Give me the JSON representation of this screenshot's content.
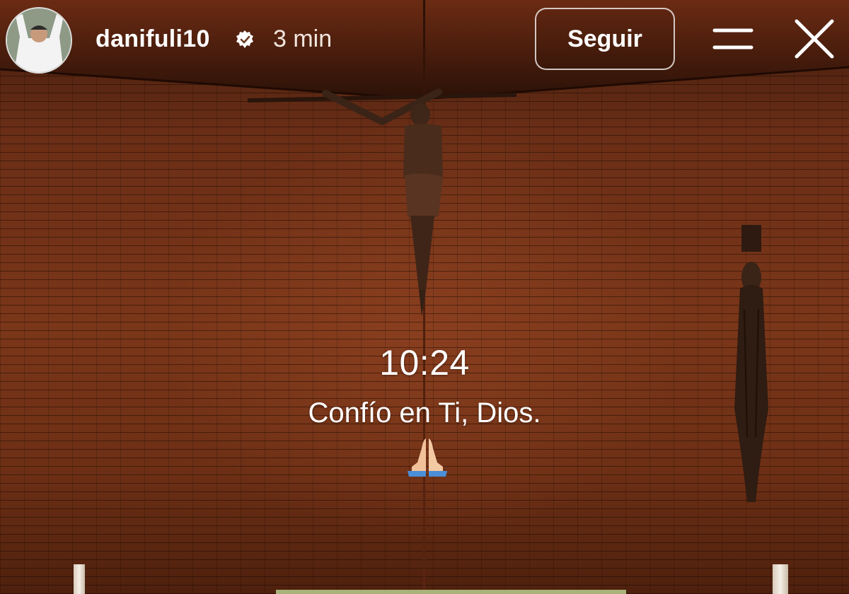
{
  "header": {
    "username": "danifuli10",
    "verified_icon": "verified-badge-icon",
    "time_ago": "3 min",
    "follow_label": "Seguir",
    "menu_icon": "menu-icon",
    "close_icon": "close-icon"
  },
  "content": {
    "clock": "10:24",
    "caption": "Confío en Ti, Dios.",
    "emoji": "🙏"
  },
  "colors": {
    "wall": "#7a3619",
    "ceiling": "#3b1a0c",
    "text": "#ffffff"
  }
}
